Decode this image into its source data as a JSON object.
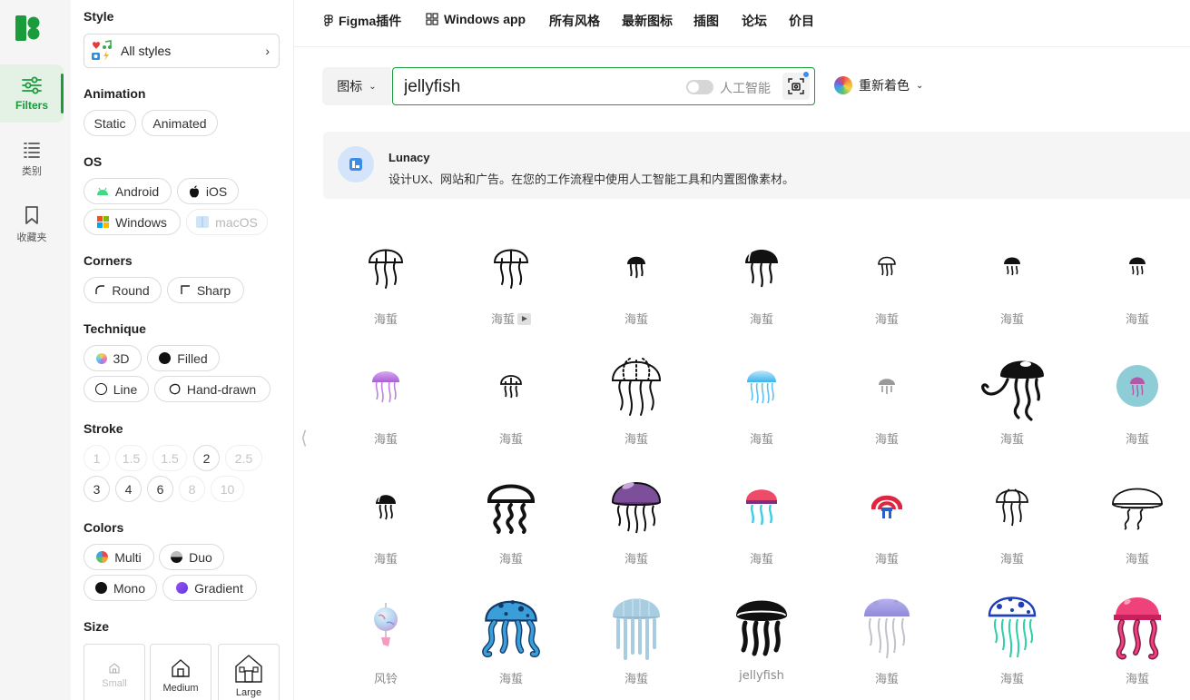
{
  "rail": {
    "items": [
      {
        "label": "Filters"
      },
      {
        "label": "类别"
      },
      {
        "label": "收藏夹"
      }
    ]
  },
  "filters": {
    "style": {
      "title": "Style",
      "value": "All styles"
    },
    "animation": {
      "title": "Animation",
      "options": [
        "Static",
        "Animated"
      ]
    },
    "os": {
      "title": "OS",
      "options": [
        "Android",
        "iOS",
        "Windows",
        "macOS"
      ]
    },
    "corners": {
      "title": "Corners",
      "options": [
        "Round",
        "Sharp"
      ]
    },
    "technique": {
      "title": "Technique",
      "options": [
        "3D",
        "Filled",
        "Line",
        "Hand-drawn"
      ]
    },
    "stroke": {
      "title": "Stroke",
      "row1": [
        "1",
        "1.5",
        "1.5",
        "2",
        "2.5"
      ],
      "row2": [
        "3",
        "4",
        "6",
        "8",
        "10"
      ]
    },
    "colors": {
      "title": "Colors",
      "options": [
        "Multi",
        "Duo",
        "Mono",
        "Gradient"
      ]
    },
    "size": {
      "title": "Size",
      "options": [
        "Small",
        "Medium",
        "Large"
      ]
    }
  },
  "topnav": {
    "items": [
      "Figma插件",
      "Windows app",
      "所有风格",
      "最新图标",
      "插图",
      "论坛",
      "价目"
    ]
  },
  "search": {
    "type_label": "图标",
    "query": "jellyfish",
    "ai_label": "人工智能",
    "recolor_label": "重新着色"
  },
  "banner": {
    "title": "Lunacy",
    "text": "设计UX、网站和广告。在您的工作流程中使用人工智能工具和内置图像素材。"
  },
  "results": [
    {
      "label": "海蜇",
      "icon": "jellyfish-outline-icon"
    },
    {
      "label": "海蜇",
      "icon": "jellyfish-outline-animated-icon",
      "animated": true
    },
    {
      "label": "海蜇",
      "icon": "jellyfish-small-filled-icon"
    },
    {
      "label": "海蜇",
      "icon": "jellyfish-filled-icon"
    },
    {
      "label": "海蜇",
      "icon": "jellyfish-small-outline-icon"
    },
    {
      "label": "海蜇",
      "icon": "jellyfish-mini-filled-icon"
    },
    {
      "label": "海蜇",
      "icon": "jellyfish-mini-filled-icon"
    },
    {
      "label": "海蜇",
      "icon": "jellyfish-purple-gradient-icon"
    },
    {
      "label": "海蜇",
      "icon": "jellyfish-small-line-icon"
    },
    {
      "label": "海蜇",
      "icon": "jellyfish-large-outline-icon"
    },
    {
      "label": "海蜇",
      "icon": "jellyfish-blue-gradient-icon"
    },
    {
      "label": "海蜇",
      "icon": "jellyfish-gray-icon"
    },
    {
      "label": "海蜇",
      "icon": "jellyfish-bold-filled-icon"
    },
    {
      "label": "海蜇",
      "icon": "jellyfish-teal-circle-icon"
    },
    {
      "label": "海蜇",
      "icon": "jellyfish-side-filled-icon"
    },
    {
      "label": "海蜇",
      "icon": "jellyfish-bold-line-icon"
    },
    {
      "label": "海蜇",
      "icon": "jellyfish-purple-3d-icon"
    },
    {
      "label": "海蜇",
      "icon": "jellyfish-pink-cyan-icon"
    },
    {
      "label": "海蜇",
      "icon": "jellyfish-red-blue-icon"
    },
    {
      "label": "海蜇",
      "icon": "jellyfish-thin-outline-icon"
    },
    {
      "label": "海蜇",
      "icon": "jellyfish-wide-outline-icon"
    },
    {
      "label": "风铃",
      "icon": "wind-chime-icon"
    },
    {
      "label": "海蜇",
      "icon": "jellyfish-blue-spotted-icon"
    },
    {
      "label": "海蜇",
      "icon": "jellyfish-lightblue-icon"
    },
    {
      "label": "jellyfish",
      "icon": "jellyfish-black-icon"
    },
    {
      "label": "海蜇",
      "icon": "jellyfish-lavender-icon"
    },
    {
      "label": "海蜇",
      "icon": "jellyfish-blue-mint-icon"
    },
    {
      "label": "海蜇",
      "icon": "jellyfish-pink-icon"
    }
  ]
}
